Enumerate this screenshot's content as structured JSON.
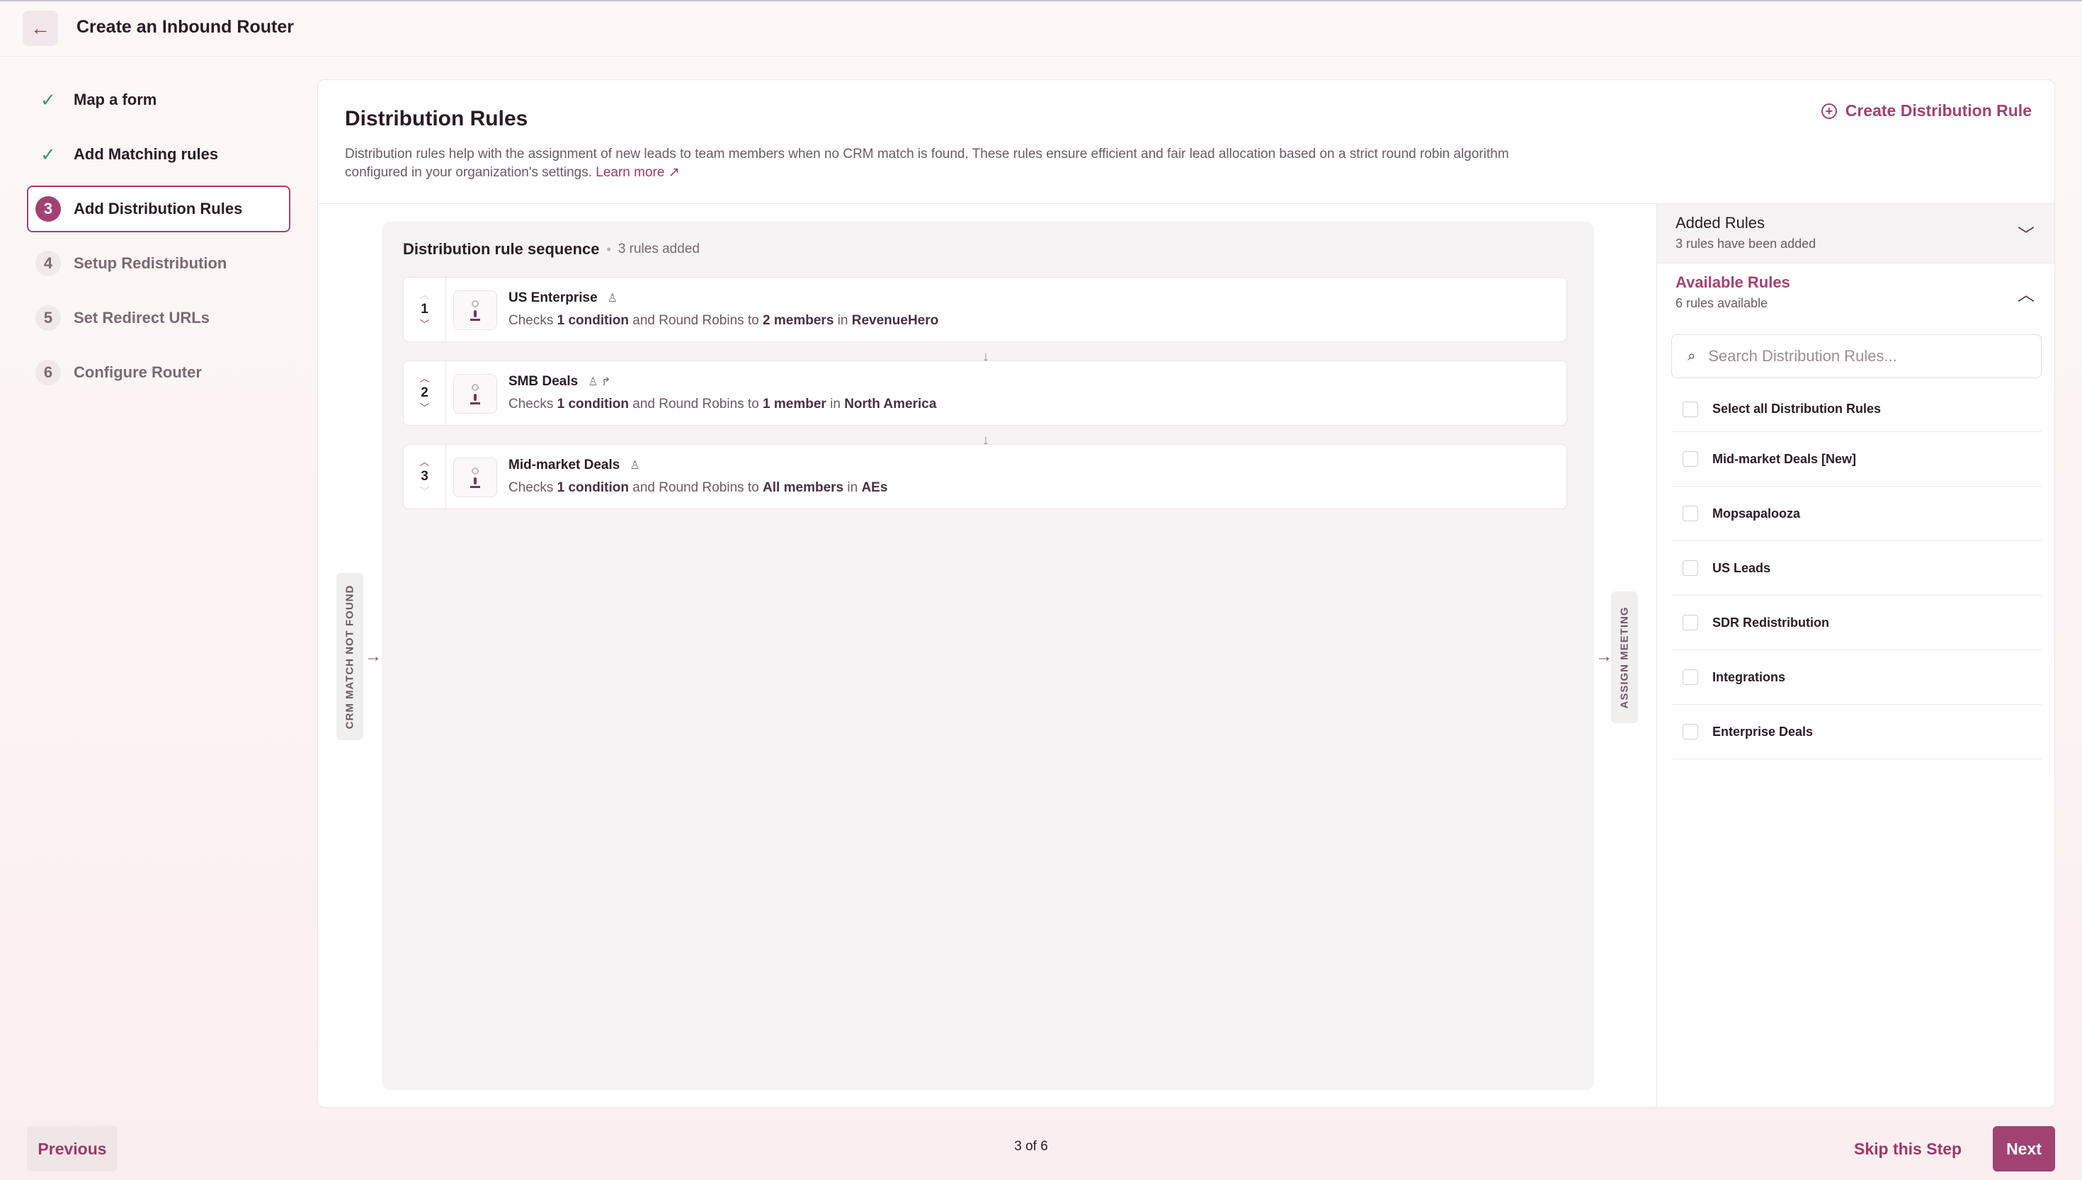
{
  "header": {
    "title": "Create an Inbound Router",
    "back_icon": "arrow-left-icon"
  },
  "steps": [
    {
      "marker": "✓",
      "label": "Map a form",
      "state": "done"
    },
    {
      "marker": "✓",
      "label": "Add Matching rules",
      "state": "done"
    },
    {
      "marker": "3",
      "label": "Add Distribution Rules",
      "state": "active"
    },
    {
      "marker": "4",
      "label": "Setup Redistribution",
      "state": "todo"
    },
    {
      "marker": "5",
      "label": "Set Redirect URLs",
      "state": "todo"
    },
    {
      "marker": "6",
      "label": "Configure Router",
      "state": "todo"
    }
  ],
  "main": {
    "title": "Distribution Rules",
    "description_line1": "Distribution rules help with the assignment of new leads to team members when no CRM match is found. These rules ensure efficient and fair lead allocation based on a strict round robin algorithm",
    "description_line2": "configured in your organization's settings.",
    "learn_more": "Learn more ↗",
    "create_rule_label": "Create Distribution Rule",
    "left_tag": "CRM MATCH NOT FOUND",
    "right_tag": "ASSIGN MEETING"
  },
  "sequence": {
    "title": "Distribution rule sequence",
    "count": "3 rules added",
    "rules": [
      {
        "order": "1",
        "name": "US Enterprise",
        "icons": "person-icon",
        "checks": "Checks",
        "conditions": "1 condition",
        "middle": "and Round Robins to",
        "members": "2 members",
        "in": "in",
        "team": "RevenueHero"
      },
      {
        "order": "2",
        "name": "SMB Deals",
        "icons": "person-icon redirect-icon",
        "checks": "Checks",
        "conditions": "1 condition",
        "middle": "and Round Robins to",
        "members": "1 member",
        "in": "in",
        "team": "North America"
      },
      {
        "order": "3",
        "name": "Mid-market Deals",
        "icons": "person-icon",
        "checks": "Checks",
        "conditions": "1 condition",
        "middle": "and Round Robins to",
        "members": "All members",
        "in": "in",
        "team": "AEs"
      }
    ]
  },
  "added_rules": {
    "title": "Added Rules",
    "subtitle": "3 rules have been added"
  },
  "available_rules": {
    "title": "Available Rules",
    "subtitle": "6 rules available",
    "search_placeholder": "Search Distribution Rules...",
    "select_all": "Select all Distribution Rules",
    "items": [
      "Mid-market Deals [New]",
      "Mopsapalooza",
      "US Leads",
      "SDR Redistribution",
      "Integrations",
      "Enterprise Deals"
    ]
  },
  "footer": {
    "previous": "Previous",
    "step_count": "3 of 6",
    "skip": "Skip this Step",
    "next": "Next"
  },
  "colors": {
    "accent": "#a14272",
    "success": "#3a9a6a",
    "muted_text": "#6c5a64"
  }
}
